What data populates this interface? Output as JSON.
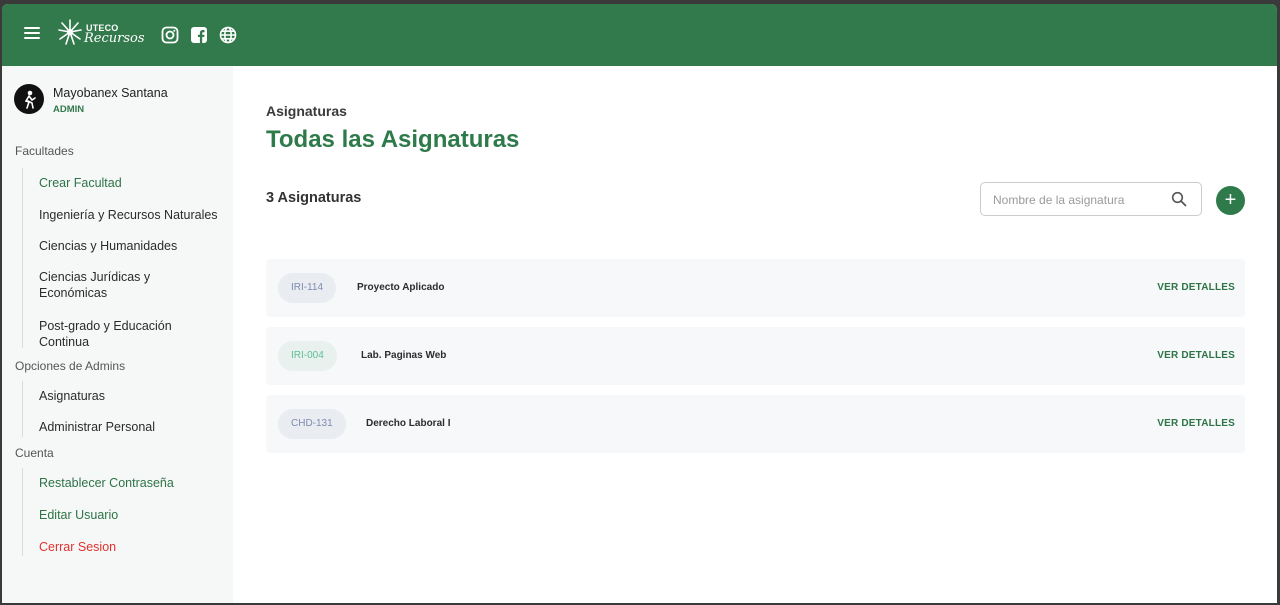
{
  "header": {
    "logo_top": "UTECO",
    "logo_script": "Recursos",
    "colors": {
      "primary": "#327a4c",
      "danger": "#e0332f"
    },
    "icons": [
      "menu-icon",
      "instagram-icon",
      "facebook-icon",
      "globe-icon"
    ]
  },
  "user": {
    "name": "Mayobanex Santana",
    "role": "ADMIN"
  },
  "sidebar": {
    "facultades": {
      "title": "Facultades",
      "items": [
        {
          "label": "Crear Facultad"
        },
        {
          "label": "Ingeniería y Recursos Naturales"
        },
        {
          "label": "Ciencias y Humanidades"
        },
        {
          "label": "Ciencias Jurídicas y"
        },
        {
          "label": "Económicas"
        },
        {
          "label": "Post-grado y Educación"
        },
        {
          "label": "Continua"
        }
      ]
    },
    "admin": {
      "title": "Opciones de Admins",
      "items": [
        {
          "label": "Asignaturas"
        },
        {
          "label": "Administrar Personal"
        }
      ]
    },
    "cuenta": {
      "title": "Cuenta",
      "items": [
        {
          "label": "Restablecer Contraseña"
        },
        {
          "label": "Editar Usuario"
        },
        {
          "label": "Cerrar Sesion"
        }
      ]
    }
  },
  "main": {
    "eyebrow": "Asignaturas",
    "title": "Todas las Asignaturas",
    "count": "3 Asignaturas",
    "search": {
      "placeholder": "Nombre de la asignatura"
    },
    "add_label": "+",
    "rows": [
      {
        "code": "IRI-114",
        "name": "Proyecto Aplicado",
        "action": "VER DETALLES"
      },
      {
        "code": "IRI-004",
        "name": "Lab. Paginas Web",
        "action": "VER DETALLES"
      },
      {
        "code": "CHD-131",
        "name": "Derecho Laboral I",
        "action": "VER DETALLES"
      }
    ]
  }
}
